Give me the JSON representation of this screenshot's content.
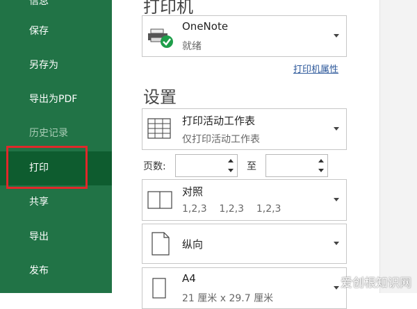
{
  "sidebar": {
    "items": [
      {
        "label": "信息"
      },
      {
        "label": "保存"
      },
      {
        "label": "另存为"
      },
      {
        "label": "导出为PDF"
      },
      {
        "label": "历史记录"
      },
      {
        "label": "打印"
      },
      {
        "label": "共享"
      },
      {
        "label": "导出"
      },
      {
        "label": "发布"
      }
    ],
    "active": "打印"
  },
  "printer": {
    "section_title": "打印机",
    "name": "OneNote",
    "status": "就绪",
    "properties_link": "打印机属性"
  },
  "settings": {
    "section_title": "设置",
    "scope": {
      "title": "打印活动工作表",
      "subtitle": "仅打印活动工作表"
    },
    "pages_label": "页数:",
    "to_label": "至",
    "pages_from": "",
    "pages_to": "",
    "collate": {
      "title": "对照",
      "subtitle": "1,2,3    1,2,3    1,2,3"
    },
    "orientation": {
      "title": "纵向"
    },
    "paper": {
      "title": "A4",
      "subtitle": "21 厘米 x 29.7 厘米"
    }
  },
  "watermark": "爱创根知识网",
  "colors": {
    "sidebar": "#217346",
    "active": "#0e5c2f",
    "highlight": "#e0282a",
    "link": "#2b579a"
  }
}
